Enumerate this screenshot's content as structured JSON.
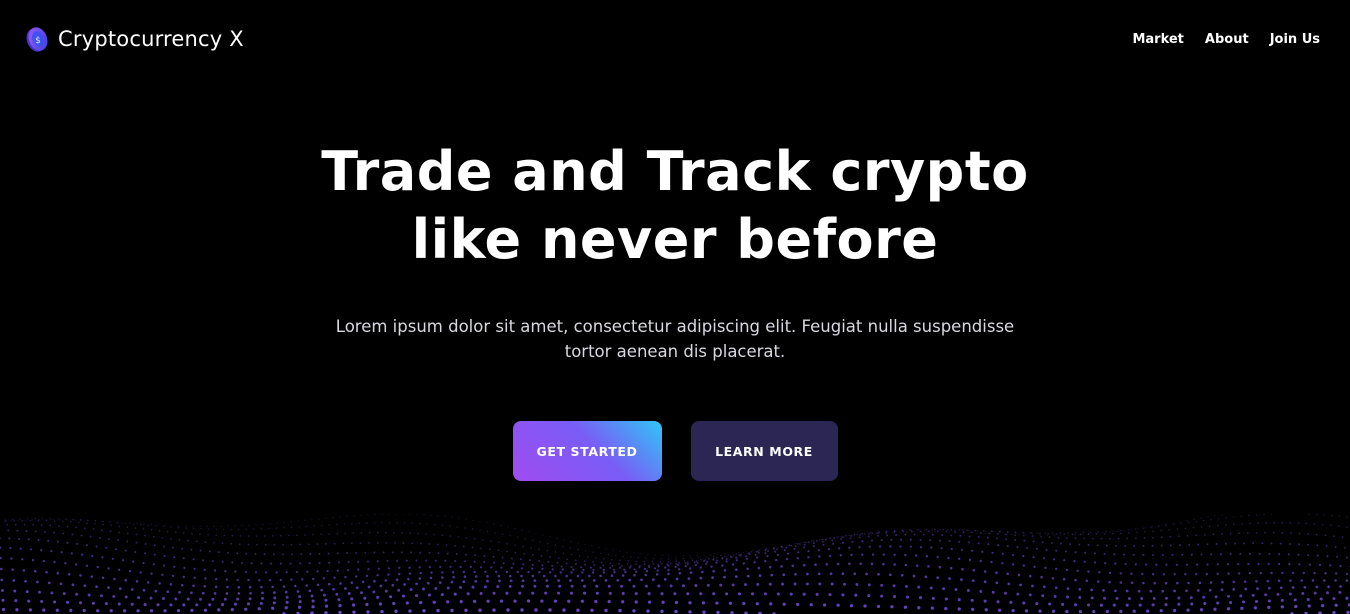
{
  "nav": {
    "brand_name": "Cryptocurrency X",
    "logo_icon": "coin-icon",
    "links": [
      "Market",
      "About",
      "Join Us"
    ]
  },
  "hero": {
    "title_line1": "Trade and Track crypto",
    "title_line2": "like never before",
    "subtitle": "Lorem ipsum dolor sit amet, consectetur adipiscing elit. Feugiat nulla suspendisse tortor aenean dis placerat.",
    "primary_button": "GET STARTED",
    "secondary_button": "LEARN MORE"
  },
  "colors": {
    "background": "#000000",
    "primary_gradient_start": "#a04cf0",
    "primary_gradient_end": "#2fc6f6",
    "secondary_button": "#2c2655",
    "dots": "#7a52e8"
  }
}
